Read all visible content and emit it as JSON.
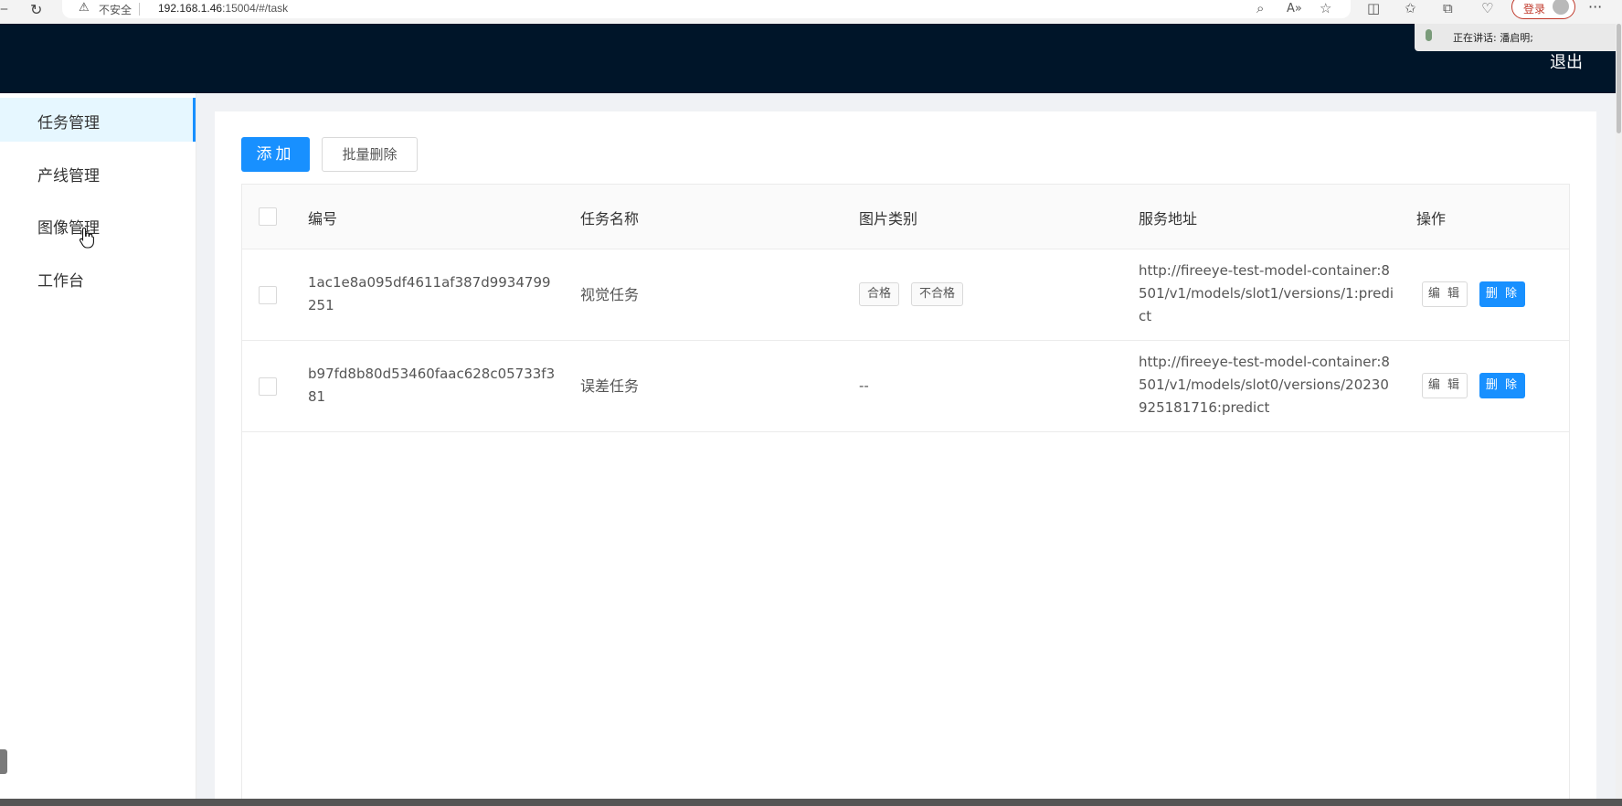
{
  "browser": {
    "back_icon": "back-arrow",
    "reload_icon": "↻",
    "warning_icon": "⚠",
    "insecure_label": "不安全",
    "url_host": "192.168.1.46",
    "url_rest": ":15004/#/task",
    "login_label": "登录",
    "more_icon": "···"
  },
  "speaking": {
    "text": "正在讲话:  潘启明;"
  },
  "header": {
    "logout_label": "退出"
  },
  "sidebar": {
    "items": [
      {
        "label": "任务管理",
        "active": true
      },
      {
        "label": "产线管理",
        "active": false
      },
      {
        "label": "图像管理",
        "active": false
      },
      {
        "label": "工作台",
        "active": false
      }
    ]
  },
  "toolbar": {
    "add_label": "添加",
    "batch_delete_label": "批量删除"
  },
  "table": {
    "columns": [
      "编号",
      "任务名称",
      "图片类别",
      "服务地址",
      "操作"
    ],
    "rows": [
      {
        "id": "1ac1e8a095df4611af387d9934799251",
        "name": "视觉任务",
        "tags": [
          "合格",
          "不合格"
        ],
        "address": "http://fireeye-test-model-container:8501/v1/models/slot1/versions/1:predict",
        "edit_label": "编 辑",
        "delete_label": "删 除"
      },
      {
        "id": "b97fd8b80d53460faac628c05733f381",
        "name": "误差任务",
        "empty_value": "--",
        "address": "http://fireeye-test-model-container:8501/v1/models/slot0/versions/20230925181716:predict",
        "edit_label": "编 辑",
        "delete_label": "删 除"
      }
    ]
  },
  "colors": {
    "header_bg": "#001529",
    "primary": "#1890ff",
    "active_menu_bg": "#e6f7ff",
    "content_bg": "#f0f2f5"
  }
}
